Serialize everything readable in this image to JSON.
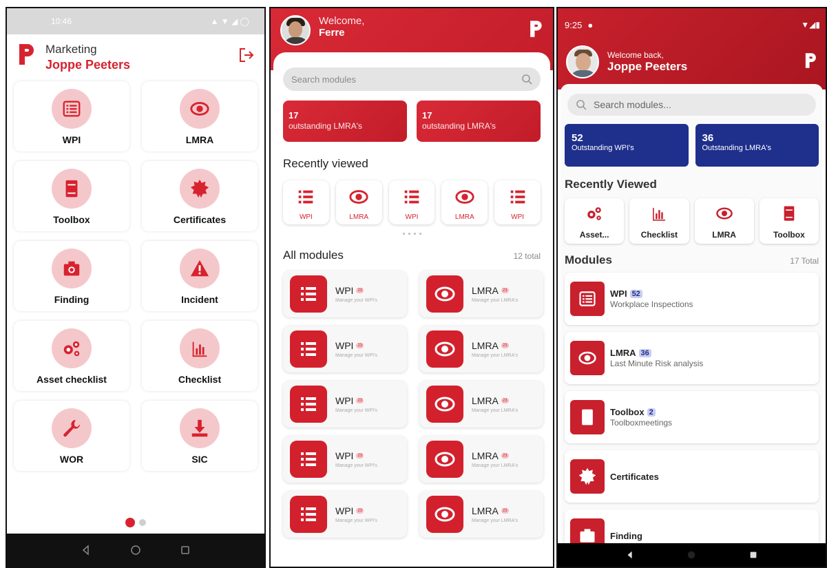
{
  "phone1": {
    "status_time": "10:46",
    "department": "Marketing",
    "user_name": "Joppe Peeters",
    "tiles": [
      {
        "label": "WPI",
        "icon": "list-icon"
      },
      {
        "label": "LMRA",
        "icon": "eye-icon"
      },
      {
        "label": "Toolbox",
        "icon": "book-icon"
      },
      {
        "label": "Certificates",
        "icon": "badge-icon"
      },
      {
        "label": "Finding",
        "icon": "camera-icon"
      },
      {
        "label": "Incident",
        "icon": "warning-icon"
      },
      {
        "label": "Asset checklist",
        "icon": "gears-icon"
      },
      {
        "label": "Checklist",
        "icon": "bar-chart-icon"
      },
      {
        "label": "WOR",
        "icon": "wrench-icon"
      },
      {
        "label": "SIC",
        "icon": "download-icon"
      }
    ]
  },
  "phone2": {
    "welcome": "Welcome,",
    "user_name": "Ferre",
    "search_placeholder": "Search modules",
    "stats": [
      {
        "number": "17",
        "text": "outstanding LMRA's"
      },
      {
        "number": "17",
        "text": "outstanding LMRA's"
      }
    ],
    "recent_title": "Recently viewed",
    "recent": [
      "WPI",
      "LMRA",
      "WPI",
      "LMRA",
      "WPI"
    ],
    "all_title": "All modules",
    "all_count": "12 total",
    "modules": [
      {
        "name": "WPI",
        "badge": "23",
        "sub": "Manage your WPI's"
      },
      {
        "name": "LMRA",
        "badge": "23",
        "sub": "Manage your LMRA's"
      },
      {
        "name": "WPI",
        "badge": "23",
        "sub": "Manage your WPI's"
      },
      {
        "name": "LMRA",
        "badge": "23",
        "sub": "Manage your LMRA's"
      },
      {
        "name": "WPI",
        "badge": "23",
        "sub": "Manage your WPI's"
      },
      {
        "name": "LMRA",
        "badge": "23",
        "sub": "Manage your LMRA's"
      },
      {
        "name": "WPI",
        "badge": "23",
        "sub": "Manage your WPI's"
      },
      {
        "name": "LMRA",
        "badge": "23",
        "sub": "Manage your LMRA's"
      },
      {
        "name": "WPI",
        "badge": "23",
        "sub": "Manage your WPI's"
      },
      {
        "name": "LMRA",
        "badge": "23",
        "sub": "Manage your LMRA's"
      }
    ]
  },
  "phone3": {
    "status_time": "9:25",
    "welcome": "Welcome back,",
    "user_name": "Joppe Peeters",
    "search_placeholder": "Search modules...",
    "stats": [
      {
        "number": "52",
        "text": "Outstanding WPI's"
      },
      {
        "number": "36",
        "text": "Outstanding LMRA's"
      }
    ],
    "recent_title": "Recently Viewed",
    "recent": [
      "Asset...",
      "Checklist",
      "LMRA",
      "Toolbox"
    ],
    "modules_title": "Modules",
    "modules_count": "17 Total",
    "modules": [
      {
        "name": "WPI",
        "badge": "52",
        "sub": "Workplace Inspections"
      },
      {
        "name": "LMRA",
        "badge": "36",
        "sub": "Last Minute Risk analysis"
      },
      {
        "name": "Toolbox",
        "badge": "2",
        "sub": "Toolboxmeetings"
      },
      {
        "name": "Certificates",
        "badge": "",
        "sub": ""
      },
      {
        "name": "Finding",
        "badge": "",
        "sub": ""
      }
    ]
  },
  "colors": {
    "brand_red": "#d7232f",
    "navy": "#1e2f8c"
  }
}
